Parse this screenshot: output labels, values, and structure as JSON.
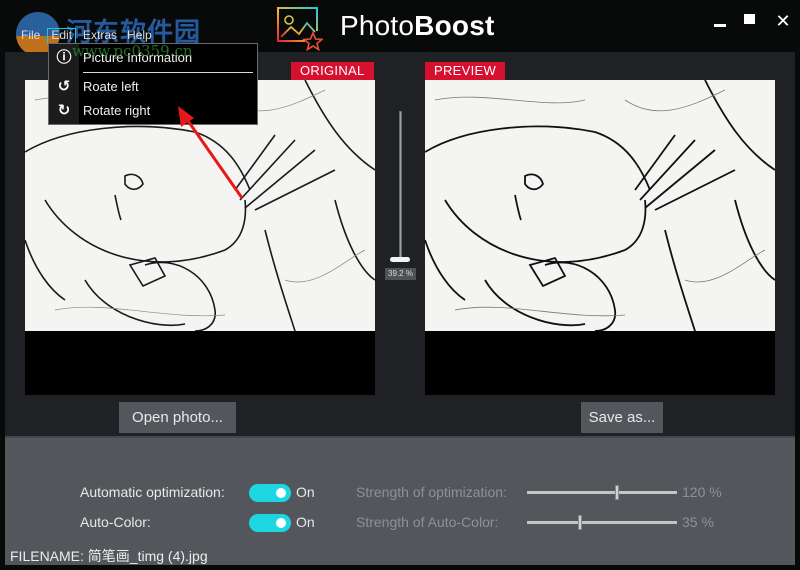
{
  "app": {
    "title_light": "Photo",
    "title_bold": "Boost",
    "logo_icon": "image-star-icon",
    "window_controls": {
      "minimize_icon": "minimize-icon",
      "maximize_icon": "maximize-icon",
      "close_icon": "close-icon",
      "close_glyph": "✕"
    }
  },
  "watermark": {
    "text": "河东软件园",
    "url": "www.pc0359.cn"
  },
  "menubar": {
    "items": [
      {
        "label": "File",
        "active": false
      },
      {
        "label": "Edit",
        "active": true
      },
      {
        "label": "Extras",
        "active": false
      },
      {
        "label": "Help",
        "active": false
      }
    ]
  },
  "edit_menu": {
    "items": [
      {
        "label": "Picture Information",
        "icon": "info-document-icon",
        "glyph": "ⓘ"
      },
      {
        "label": "Roate left",
        "icon": "rotate-left-icon",
        "glyph": "↺"
      },
      {
        "label": "Rotate right",
        "icon": "rotate-right-icon",
        "glyph": "↻"
      }
    ]
  },
  "panels": {
    "original_label": "ORIGINAL",
    "preview_label": "PREVIEW"
  },
  "zoom_slider": {
    "value_label": "39.2 %",
    "value_percent": 39.2
  },
  "buttons": {
    "open_photo": "Open photo...",
    "save_as": "Save as..."
  },
  "settings": {
    "auto_optimization": {
      "label": "Automatic optimization:",
      "state": "On",
      "strength_label": "Strength of optimization:",
      "strength_value": "120 %",
      "strength_fraction": 0.6
    },
    "auto_color": {
      "label": "Auto-Color:",
      "state": "On",
      "strength_label": "Strength of Auto-Color:",
      "strength_value": "35 %",
      "strength_fraction": 0.35
    }
  },
  "status": {
    "filename": "FILENAME: 简笔画_timg (4).jpg"
  },
  "colors": {
    "accent_toggle": "#1ed6e2",
    "label_red": "#d6102f",
    "annotation_arrow": "#e81818"
  }
}
